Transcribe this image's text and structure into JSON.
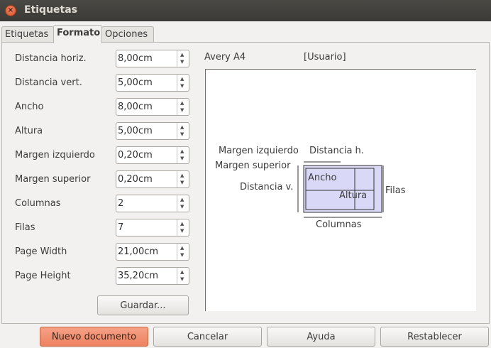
{
  "window": {
    "title": "Etiquetas",
    "close_glyph": "×"
  },
  "tabs": [
    {
      "label": "Etiquetas",
      "active": false
    },
    {
      "label": "Formato",
      "active": true
    },
    {
      "label": "Opciones",
      "active": false
    }
  ],
  "fields": [
    {
      "label": "Distancia horiz.",
      "value": "8,00cm"
    },
    {
      "label": "Distancia vert.",
      "value": "5,00cm"
    },
    {
      "label": "Ancho",
      "value": "8,00cm"
    },
    {
      "label": "Altura",
      "value": "5,00cm"
    },
    {
      "label": "Margen izquierdo",
      "value": "0,20cm"
    },
    {
      "label": "Margen superior",
      "value": "0,20cm"
    },
    {
      "label": "Columnas",
      "value": "2"
    },
    {
      "label": "Filas",
      "value": "7"
    },
    {
      "label": "Page Width",
      "value": "21,00cm"
    },
    {
      "label": "Page Height",
      "value": "35,20cm"
    }
  ],
  "save_label": "Guardar...",
  "preview": {
    "brand": "Avery A4",
    "type": "[Usuario]",
    "labels": {
      "left_margin": "Margen izquierdo",
      "h_distance": "Distancia h.",
      "top_margin": "Margen superior",
      "v_distance": "Distancia v.",
      "width": "Ancho",
      "height": "Altura",
      "rows": "Filas",
      "columns": "Columnas"
    },
    "label_fill_color": "#d9d9f7"
  },
  "buttons": {
    "new_document": "Nuevo documento",
    "cancel": "Cancelar",
    "help": "Ayuda",
    "reset": "Restablecer"
  },
  "colors": {
    "primary_button": "#ee8262",
    "titlebar": "#3b3a36"
  }
}
